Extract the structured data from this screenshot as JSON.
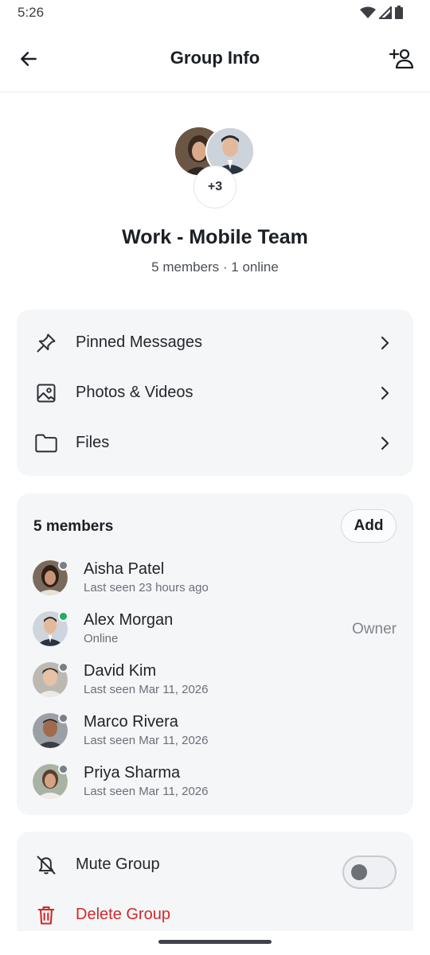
{
  "status_bar": {
    "time": "5:26"
  },
  "header": {
    "title": "Group Info"
  },
  "group": {
    "more_count": "+3",
    "name": "Work - Mobile Team",
    "subtitle": "5 members · 1 online"
  },
  "media_menu": [
    {
      "label": "Pinned Messages",
      "icon": "pin-icon"
    },
    {
      "label": "Photos & Videos",
      "icon": "image-icon"
    },
    {
      "label": "Files",
      "icon": "folder-icon"
    }
  ],
  "members": {
    "title": "5 members",
    "add_label": "Add",
    "list": [
      {
        "name": "Aisha Patel",
        "status": "Last seen 23 hours ago",
        "role": "",
        "online": false
      },
      {
        "name": "Alex Morgan",
        "status": "Online",
        "role": "Owner",
        "online": true
      },
      {
        "name": "David Kim",
        "status": "Last seen Mar 11, 2026",
        "role": "",
        "online": false
      },
      {
        "name": "Marco Rivera",
        "status": "Last seen Mar 11, 2026",
        "role": "",
        "online": false
      },
      {
        "name": "Priya Sharma",
        "status": "Last seen Mar 11, 2026",
        "role": "",
        "online": false
      }
    ]
  },
  "settings": {
    "mute_label": "Mute Group",
    "mute_on": false,
    "delete_label": "Delete Group"
  },
  "colors": {
    "online": "#1fae62",
    "offline": "#7a7e85",
    "danger": "#d02a2a",
    "card_bg": "#f4f6f8"
  }
}
